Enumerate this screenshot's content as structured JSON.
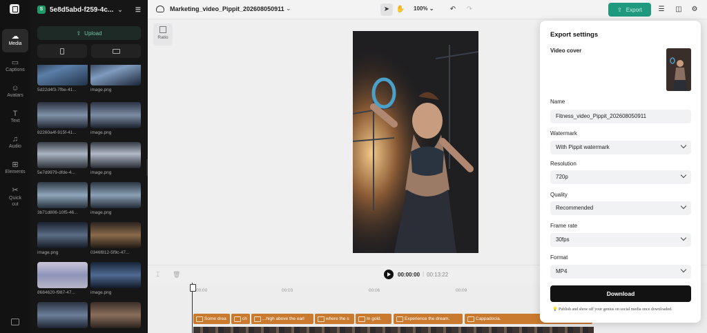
{
  "project": {
    "name": "5e8d5abd-f259-4c...",
    "badge": "S"
  },
  "rail": [
    {
      "key": "media",
      "label": "Media",
      "icon": "cloud-icon"
    },
    {
      "key": "captions",
      "label": "Captions",
      "icon": "captions-icon"
    },
    {
      "key": "avatars",
      "label": "Avatars",
      "icon": "avatar-icon"
    },
    {
      "key": "text",
      "label": "Text",
      "icon": "text-icon"
    },
    {
      "key": "audio",
      "label": "Audio",
      "icon": "music-icon"
    },
    {
      "key": "elements",
      "label": "Elements",
      "icon": "elements-icon"
    },
    {
      "key": "quickcut",
      "label": "Quick cut",
      "icon": "scissors-icon"
    }
  ],
  "media": {
    "upload_label": "Upload",
    "items": [
      {
        "caption": "5d22d4f3-7fbe-41..."
      },
      {
        "caption": "image.png"
      },
      {
        "caption": "82260a4f-915f-41..."
      },
      {
        "caption": "image.png"
      },
      {
        "caption": "5e7d9979-dfde-4..."
      },
      {
        "caption": "image.png"
      },
      {
        "caption": "3b71d806-10f5-46..."
      },
      {
        "caption": "image.png"
      },
      {
        "caption": "image.png"
      },
      {
        "caption": "0346f812-5f9c-47..."
      },
      {
        "caption": "8684620-f987-47..."
      },
      {
        "caption": "image.png"
      },
      {
        "caption": ""
      },
      {
        "caption": ""
      }
    ]
  },
  "editor": {
    "title": "Marketing_video_Pippit_202608050911",
    "zoom": "100%",
    "export_label": "Export",
    "ratio_label": "Ratio"
  },
  "playback": {
    "current": "00:00:00",
    "total": "00:13:22"
  },
  "timeline": {
    "ruler": [
      "00:00",
      "00:03",
      "00:06",
      "00:09"
    ],
    "captions": [
      {
        "text": "Some drea"
      },
      {
        "text": "ch"
      },
      {
        "text": "...high above the earl"
      },
      {
        "text": "where the s"
      },
      {
        "text": "In gold."
      },
      {
        "text": "Experience the dream."
      },
      {
        "text": "Cappadocia."
      }
    ]
  },
  "export_settings": {
    "title": "Export settings",
    "video_cover_label": "Video cover",
    "name_label": "Name",
    "name_value": "Fitness_video_Pippit_202608050911",
    "watermark_label": "Watermark",
    "watermark_value": "With Pippit watermark",
    "resolution_label": "Resolution",
    "resolution_value": "720p",
    "quality_label": "Quality",
    "quality_value": "Recommended",
    "framerate_label": "Frame rate",
    "framerate_value": "30fps",
    "format_label": "Format",
    "format_value": "MP4",
    "download_label": "Download",
    "hint": "Publish and show off your genius on social media once downloaded."
  },
  "colors": {
    "accent": "#1f9a7e",
    "caption_chip": "#c97a2f",
    "primary_button": "#121212"
  }
}
